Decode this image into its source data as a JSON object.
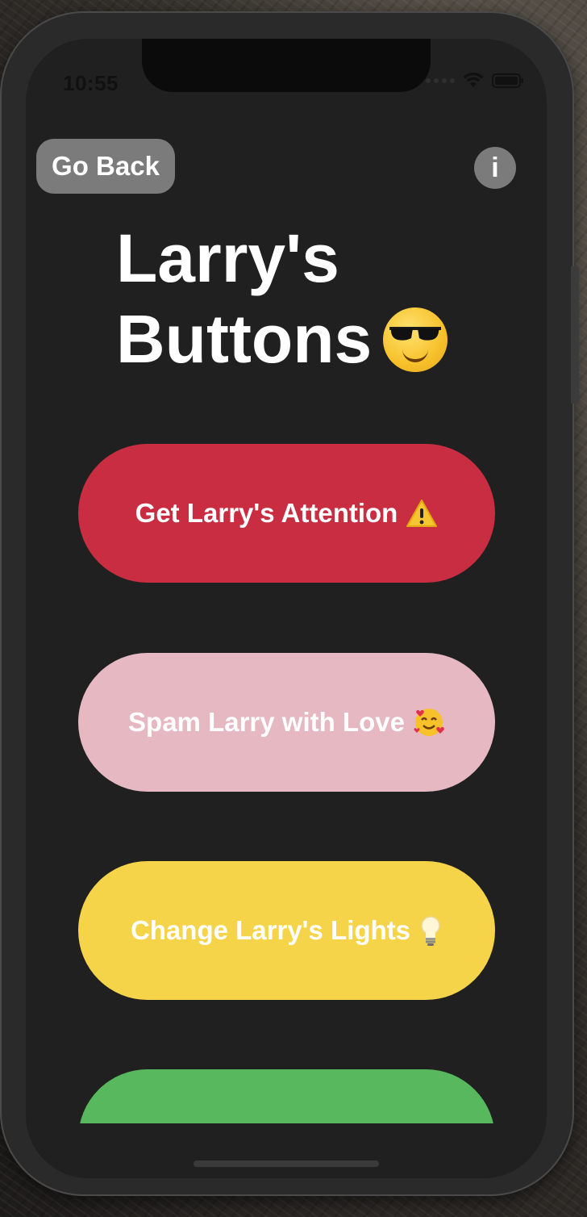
{
  "status_bar": {
    "time": "10:55"
  },
  "nav": {
    "back_label": "Go Back",
    "info_label": "i"
  },
  "title": {
    "line1": "Larry's",
    "line2": "Buttons"
  },
  "buttons": [
    {
      "label": "Get Larry's Attention",
      "icon": "warning-icon",
      "color": "#c82d42"
    },
    {
      "label": "Spam Larry with Love",
      "icon": "smiling-face-with-hearts-icon",
      "color": "#e5b8c2"
    },
    {
      "label": "Change Larry's Lights",
      "icon": "light-bulb-icon",
      "color": "#f6d44a"
    },
    {
      "label": "",
      "icon": "",
      "color": "#58b85e"
    }
  ],
  "colors": {
    "screen_bg": "#202020",
    "nav_button": "#7b7b7b",
    "text": "#ffffff"
  }
}
